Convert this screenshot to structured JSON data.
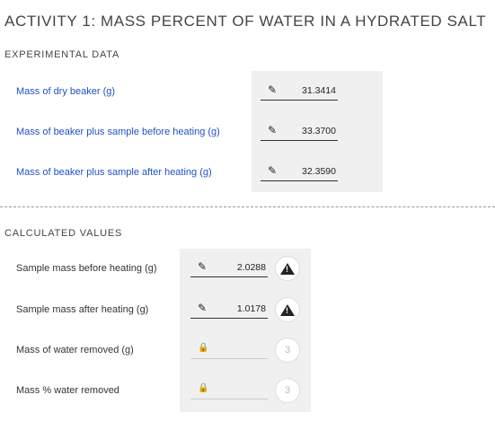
{
  "title": "ACTIVITY 1: MASS PERCENT OF WATER IN A HYDRATED SALT",
  "experimental": {
    "heading": "EXPERIMENTAL DATA",
    "rows": [
      {
        "label": "Mass of dry beaker (g)",
        "value": "31.3414"
      },
      {
        "label": "Mass of beaker plus sample before heating (g)",
        "value": "33.3700"
      },
      {
        "label": "Mass of beaker plus sample after heating (g)",
        "value": "32.3590"
      }
    ]
  },
  "calculated": {
    "heading": "CALCULATED VALUES",
    "rows": [
      {
        "label": "Sample mass before heating (g)",
        "value": "2.0288",
        "editable": true,
        "badge_icon": "warning-icon"
      },
      {
        "label": "Sample mass after heating (g)",
        "value": "1.0178",
        "editable": true,
        "badge_icon": "warning-icon"
      },
      {
        "label": "Mass of water removed (g)",
        "value": "",
        "editable": false,
        "attempts": "3"
      },
      {
        "label": "Mass % water removed",
        "value": "",
        "editable": false,
        "attempts": "3"
      }
    ]
  },
  "colors": {
    "label_link": "#2050c8",
    "panel_bg": "#f0f0f0"
  }
}
